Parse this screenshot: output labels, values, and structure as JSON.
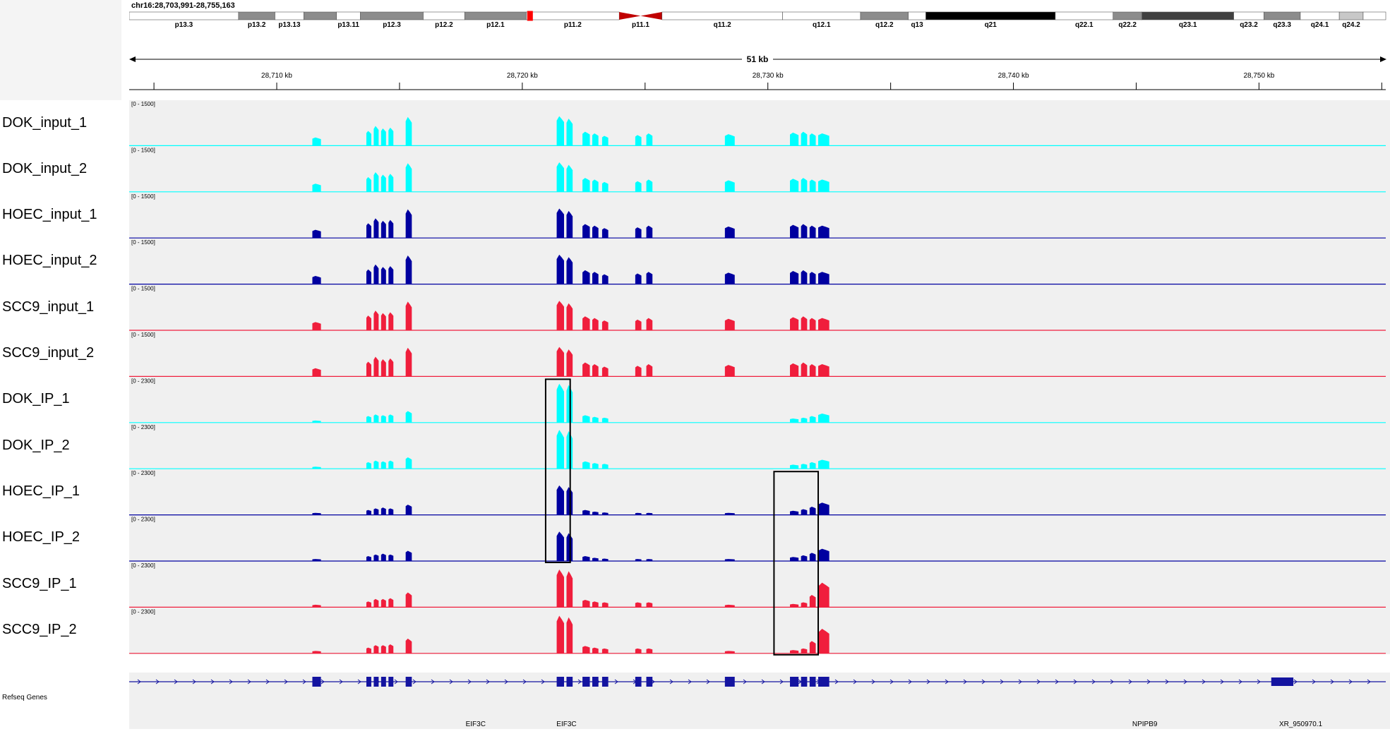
{
  "locus": "chr16:28,703,991-28,755,163",
  "genome_span": {
    "start": 28703991,
    "end": 28755163
  },
  "span_label": "51 kb",
  "ruler_ticks": [
    {
      "pos": 28705000,
      "label": ""
    },
    {
      "pos": 28710000,
      "label": "28,710 kb"
    },
    {
      "pos": 28715000,
      "label": ""
    },
    {
      "pos": 28720000,
      "label": "28,720 kb"
    },
    {
      "pos": 28725000,
      "label": ""
    },
    {
      "pos": 28730000,
      "label": "28,730 kb"
    },
    {
      "pos": 28735000,
      "label": ""
    },
    {
      "pos": 28740000,
      "label": "28,740 kb"
    },
    {
      "pos": 28745000,
      "label": ""
    },
    {
      "pos": 28750000,
      "label": "28,750 kb"
    },
    {
      "pos": 28755000,
      "label": ""
    }
  ],
  "ideogram_bands": [
    {
      "label": "p13.3",
      "s": 0,
      "e": 0.087,
      "c": "#ffffff"
    },
    {
      "label": "p13.2",
      "s": 0.087,
      "e": 0.116,
      "c": "#8c8c8c"
    },
    {
      "label": "p13.13",
      "s": 0.116,
      "e": 0.139,
      "c": "#ffffff"
    },
    {
      "label": "",
      "s": 0.139,
      "e": 0.165,
      "c": "#8c8c8c"
    },
    {
      "label": "p13.11",
      "s": 0.165,
      "e": 0.184,
      "c": "#ffffff"
    },
    {
      "label": "p12.3",
      "s": 0.184,
      "e": 0.234,
      "c": "#8c8c8c"
    },
    {
      "label": "p12.2",
      "s": 0.234,
      "e": 0.267,
      "c": "#ffffff"
    },
    {
      "label": "p12.1",
      "s": 0.267,
      "e": 0.316,
      "c": "#8c8c8c"
    },
    {
      "label": "p11.2",
      "s": 0.316,
      "e": 0.39,
      "c": "#ffffff"
    },
    {
      "label": "p11.1",
      "s": 0.39,
      "e": 0.424,
      "c": "#ffffff"
    },
    {
      "label": "q11.2",
      "s": 0.424,
      "e": 0.52,
      "c": "#ffffff"
    },
    {
      "label": "q12.1",
      "s": 0.52,
      "e": 0.582,
      "c": "#ffffff"
    },
    {
      "label": "q12.2",
      "s": 0.582,
      "e": 0.62,
      "c": "#8c8c8c"
    },
    {
      "label": "q13",
      "s": 0.62,
      "e": 0.634,
      "c": "#ffffff"
    },
    {
      "label": "q21",
      "s": 0.634,
      "e": 0.737,
      "c": "#000000"
    },
    {
      "label": "q22.1",
      "s": 0.737,
      "e": 0.783,
      "c": "#ffffff"
    },
    {
      "label": "q22.2",
      "s": 0.783,
      "e": 0.806,
      "c": "#8c8c8c"
    },
    {
      "label": "q23.1",
      "s": 0.806,
      "e": 0.879,
      "c": "#404040"
    },
    {
      "label": "q23.2",
      "s": 0.879,
      "e": 0.903,
      "c": "#ffffff"
    },
    {
      "label": "q23.3",
      "s": 0.903,
      "e": 0.932,
      "c": "#8c8c8c"
    },
    {
      "label": "q24.1",
      "s": 0.932,
      "e": 0.963,
      "c": "#ffffff"
    },
    {
      "label": "q24.2",
      "s": 0.963,
      "e": 0.982,
      "c": "#c8c8c8"
    },
    {
      "label": "",
      "s": 0.982,
      "e": 1.0,
      "c": "#ffffff"
    }
  ],
  "ideogram_locus_fraction": 0.3187,
  "colors": {
    "cyan": "#00ffff",
    "navy": "#0000a0",
    "red": "#f01e3c",
    "gene": "#1414a0"
  },
  "tracks": [
    {
      "name": "DOK_input_1",
      "scale": "[0 - 1500]",
      "color": "#00ffff",
      "set": "input"
    },
    {
      "name": "DOK_input_2",
      "scale": "[0 - 1500]",
      "color": "#00ffff",
      "set": "input"
    },
    {
      "name": "HOEC_input_1",
      "scale": "[0 - 1500]",
      "color": "#0000a0",
      "set": "input"
    },
    {
      "name": "HOEC_input_2",
      "scale": "[0 - 1500]",
      "color": "#0000a0",
      "set": "input"
    },
    {
      "name": "SCC9_input_1",
      "scale": "[0 - 1500]",
      "color": "#f01e3c",
      "set": "input"
    },
    {
      "name": "SCC9_input_2",
      "scale": "[0 - 1500]",
      "color": "#f01e3c",
      "set": "input"
    },
    {
      "name": "DOK_IP_1",
      "scale": "[0 - 2300]",
      "color": "#00ffff",
      "set": "ipdok"
    },
    {
      "name": "DOK_IP_2",
      "scale": "[0 - 2300]",
      "color": "#00ffff",
      "set": "ipdok"
    },
    {
      "name": "HOEC_IP_1",
      "scale": "[0 - 2300]",
      "color": "#0000a0",
      "set": "iphoec"
    },
    {
      "name": "HOEC_IP_2",
      "scale": "[0 - 2300]",
      "color": "#0000a0",
      "set": "iphoec"
    },
    {
      "name": "SCC9_IP_1",
      "scale": "[0 - 2300]",
      "color": "#f01e3c",
      "set": "ipscc"
    },
    {
      "name": "SCC9_IP_2",
      "scale": "[0 - 2300]",
      "color": "#f01e3c",
      "set": "ipscc"
    }
  ],
  "exons": [
    {
      "s": 28711450,
      "e": 28711800
    },
    {
      "s": 28713650,
      "e": 28713850
    },
    {
      "s": 28713950,
      "e": 28714150
    },
    {
      "s": 28714250,
      "e": 28714450
    },
    {
      "s": 28714550,
      "e": 28714750
    },
    {
      "s": 28715250,
      "e": 28715500
    },
    {
      "s": 28721400,
      "e": 28721700
    },
    {
      "s": 28721800,
      "e": 28722050
    },
    {
      "s": 28722450,
      "e": 28722750
    },
    {
      "s": 28722850,
      "e": 28723100
    },
    {
      "s": 28723250,
      "e": 28723500
    },
    {
      "s": 28724600,
      "e": 28724850
    },
    {
      "s": 28725050,
      "e": 28725300
    },
    {
      "s": 28728250,
      "e": 28728650
    },
    {
      "s": 28730900,
      "e": 28731250
    },
    {
      "s": 28731350,
      "e": 28731600
    },
    {
      "s": 28731700,
      "e": 28731950
    },
    {
      "s": 28732050,
      "e": 28732500
    }
  ],
  "signal_levels": {
    "input": [
      0.2,
      0.36,
      0.48,
      0.42,
      0.44,
      0.7,
      0.72,
      0.66,
      0.34,
      0.3,
      0.24,
      0.26,
      0.3,
      0.28,
      0.32,
      0.34,
      0.3,
      0.3
    ],
    "ipdok": [
      0.05,
      0.16,
      0.2,
      0.18,
      0.2,
      0.28,
      0.95,
      0.92,
      0.18,
      0.14,
      0.12,
      0.0,
      0.0,
      0.0,
      0.1,
      0.12,
      0.16,
      0.22
    ],
    "iphoec": [
      0.05,
      0.12,
      0.16,
      0.18,
      0.16,
      0.25,
      0.72,
      0.68,
      0.12,
      0.08,
      0.06,
      0.05,
      0.05,
      0.05,
      0.1,
      0.14,
      0.2,
      0.3
    ],
    "ipscc": [
      0.06,
      0.14,
      0.2,
      0.2,
      0.22,
      0.36,
      0.92,
      0.88,
      0.18,
      0.14,
      0.12,
      0.12,
      0.12,
      0.06,
      0.08,
      0.12,
      0.3,
      0.6
    ]
  },
  "highlight_boxes": [
    {
      "s": 28720950,
      "e": 28721950,
      "from": 6,
      "to": 9
    },
    {
      "s": 28730250,
      "e": 28732050,
      "from": 8,
      "to": 11
    }
  ],
  "gene_track_label": "Refseq Genes",
  "gene_labels": [
    {
      "pos": 28718100,
      "text": "EIF3C"
    },
    {
      "pos": 28721800,
      "text": "EIF3C"
    },
    {
      "pos": 28745350,
      "text": "NPIPB9"
    },
    {
      "pos": 28751700,
      "text": "XR_950970.1"
    }
  ],
  "gene_line_extra_blocks": [
    {
      "s": 28750500,
      "e": 28751400
    }
  ]
}
